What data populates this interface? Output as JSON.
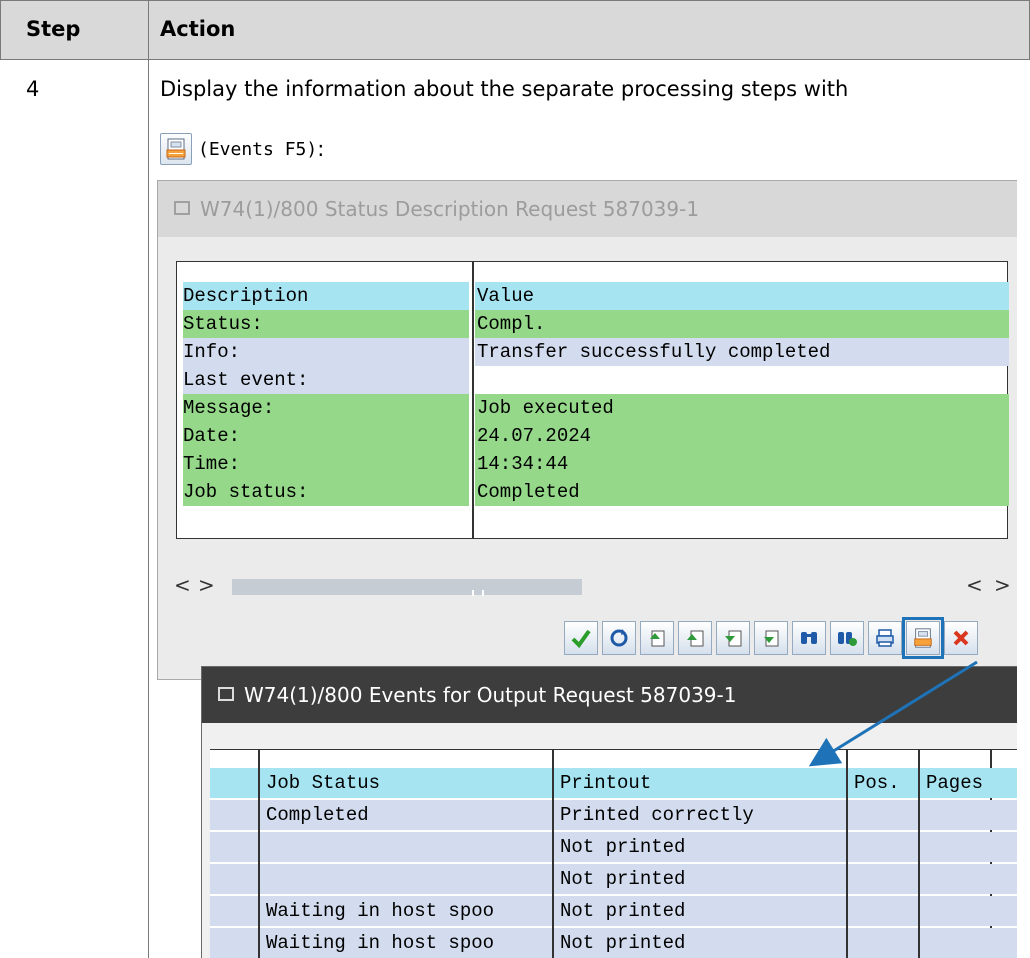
{
  "doc": {
    "header": {
      "step": "Step",
      "action": "Action"
    },
    "row": {
      "step_number": "4",
      "text_line1": "Display the information about the separate processing steps with",
      "text_line2_code": "(Events F5)",
      "text_line2_suffix": ":"
    }
  },
  "status_window": {
    "title": "W74(1)/800 Status Description Request 587039-1",
    "rows": [
      {
        "label": "Description",
        "value": "Value",
        "color": "#a6e4f2"
      },
      {
        "label": "Status:",
        "value": "Compl.",
        "color": "#95d88a"
      },
      {
        "label": "Info:",
        "value": "Transfer successfully completed",
        "color": "#d2dcee"
      },
      {
        "label": "Last event:",
        "value": "",
        "color": "#d2dcee"
      },
      {
        "label": "Message:",
        "value": "Job executed",
        "color": "#95d88a"
      },
      {
        "label": "Date:",
        "value": "24.07.2024",
        "color": "#95d88a"
      },
      {
        "label": "Time:",
        "value": "14:34:44",
        "color": "#95d88a"
      },
      {
        "label": "Job status:",
        "value": "Completed",
        "color": "#95d88a"
      }
    ],
    "scroll_left": "< >",
    "scroll_right": "< >",
    "toolbar": [
      "check-icon",
      "refresh-icon",
      "page-first-icon",
      "page-up-icon",
      "page-down-icon",
      "page-last-icon",
      "find-icon",
      "find-next-icon",
      "print-icon",
      "events-icon"
    ]
  },
  "events_window": {
    "title": "W74(1)/800 Events for Output Request 587039-1",
    "headers": [
      "",
      "Job Status",
      "Printout",
      "Pos.",
      "Pages"
    ],
    "rows": [
      [
        "",
        "Completed",
        "Printed correctly",
        "",
        ""
      ],
      [
        "",
        "",
        "Not printed",
        "",
        ""
      ],
      [
        "",
        "",
        "Not printed",
        "",
        ""
      ],
      [
        "",
        "Waiting in host spoo",
        "Not printed",
        "",
        ""
      ],
      [
        "",
        "Waiting in host spoo",
        "Not printed",
        "",
        ""
      ]
    ],
    "header_color": "#a6e4f2",
    "row_color": "#d2dcee"
  },
  "colors": {
    "accent": "#1e73b8",
    "header_bg": "#d9d9d9"
  }
}
